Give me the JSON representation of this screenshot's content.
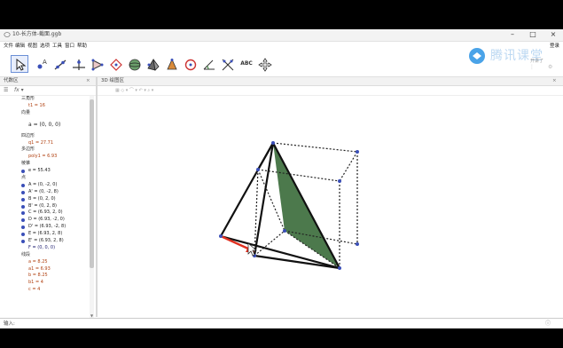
{
  "window": {
    "title": "10-长方体-截面.ggb",
    "controls": {
      "minimize": "–",
      "maximize": "□",
      "close": "×"
    }
  },
  "menu": {
    "items": [
      "文件",
      "编辑",
      "视图",
      "选项",
      "工具",
      "窗口",
      "帮助"
    ],
    "login": "登录"
  },
  "toolbar": {
    "tools": [
      "move-tool",
      "point-tool",
      "line-tool",
      "perpendicular-tool",
      "polygon-tool",
      "circle-tool",
      "sphere-tool",
      "pyramid-tool",
      "cone-tool",
      "angle-tool",
      "reflect-tool",
      "slider-tool",
      "text-tool",
      "move-view-tool"
    ],
    "text_tool_label": "ABC"
  },
  "watermark": {
    "text": "腾讯课堂",
    "sub": "开讲了"
  },
  "algebra": {
    "header": "代数区",
    "fx_label": "fx ▾",
    "rows": [
      {
        "kind": "cat",
        "text": "三角形"
      },
      {
        "kind": "item",
        "text": "t1 = 16",
        "color": "red"
      },
      {
        "kind": "cat",
        "text": "向量"
      },
      {
        "kind": "vec",
        "text": "a = (0, 0, 0)"
      },
      {
        "kind": "cat",
        "text": "四边形"
      },
      {
        "kind": "item",
        "text": "q1 = 27.71",
        "color": "red"
      },
      {
        "kind": "cat",
        "text": "多边形"
      },
      {
        "kind": "item",
        "text": "poly1 = 6.93",
        "color": "red"
      },
      {
        "kind": "cat",
        "text": "棱锥"
      },
      {
        "kind": "dot",
        "text": "e = 55.43"
      },
      {
        "kind": "cat",
        "text": "点"
      },
      {
        "kind": "dot",
        "text": "A = (0, -2, 0)"
      },
      {
        "kind": "dot",
        "text": "A' = (0, -2, 8)"
      },
      {
        "kind": "dot",
        "text": "B = (0, 2, 0)"
      },
      {
        "kind": "dot",
        "text": "B' = (0, 2, 8)"
      },
      {
        "kind": "dot",
        "text": "C = (6.93, 2, 0)"
      },
      {
        "kind": "dot",
        "text": "D = (6.93, -2, 0)"
      },
      {
        "kind": "dot",
        "text": "D' = (6.93, -2, 8)"
      },
      {
        "kind": "dot",
        "text": "E = (6.93, 2, 8)"
      },
      {
        "kind": "dot",
        "text": "E' = (6.93, 2, 8)"
      },
      {
        "kind": "item",
        "text": "F = (0, 0, 0)",
        "color": "blue"
      },
      {
        "kind": "cat",
        "text": "线段"
      },
      {
        "kind": "item",
        "text": "a = 8.25",
        "color": "red"
      },
      {
        "kind": "item",
        "text": "a1 = 6.93",
        "color": "red"
      },
      {
        "kind": "item",
        "text": "b = 8.25",
        "color": "red"
      },
      {
        "kind": "item",
        "text": "b1 = 4",
        "color": "red"
      },
      {
        "kind": "item",
        "text": "c = 4",
        "color": "red"
      }
    ]
  },
  "graphics3d": {
    "header": "3D 绘图区",
    "style_bar": "▦ ◇ ▾ ⌒ ▾ ↶ ▾ ⌕ ▾"
  },
  "input_bar": {
    "label": "输入:",
    "help": "ⓘ"
  },
  "colors": {
    "section_fill": "#3d6e3d",
    "vector_red": "#e03020",
    "point_blue": "#3a4fb8",
    "line_black": "#111111"
  }
}
